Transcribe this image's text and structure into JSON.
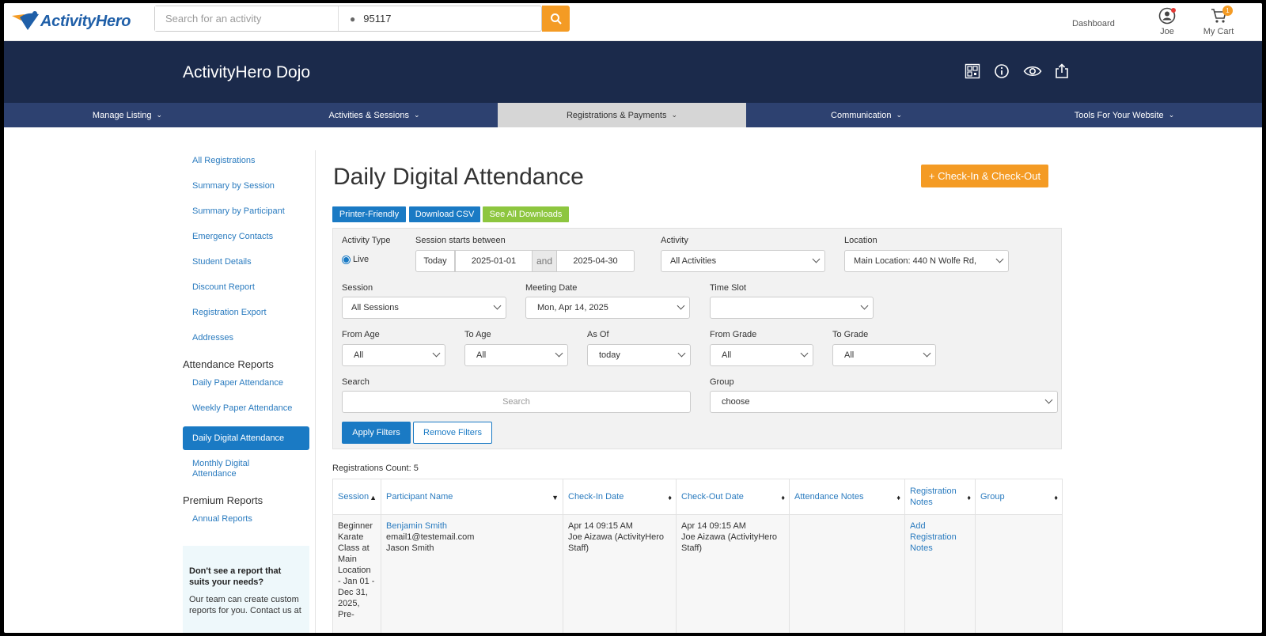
{
  "topbar": {
    "brand": "ActivityHero",
    "search_placeholder": "Search for an activity",
    "zip": "95117",
    "dashboard": "Dashboard",
    "user": "Joe",
    "cart": "My Cart",
    "cart_count": "1"
  },
  "header": {
    "org_name": "ActivityHero Dojo"
  },
  "nav": [
    {
      "label": "Manage Listing"
    },
    {
      "label": "Activities & Sessions"
    },
    {
      "label": "Registrations & Payments"
    },
    {
      "label": "Communication"
    },
    {
      "label": "Tools For Your Website"
    }
  ],
  "sidebar": {
    "links": [
      "All Registrations",
      "Summary by Session",
      "Summary by Participant",
      "Emergency Contacts",
      "Student Details",
      "Discount Report",
      "Registration Export",
      "Addresses"
    ],
    "attendance_heading": "Attendance Reports",
    "attendance_links": [
      "Daily Paper Attendance",
      "Weekly Paper Attendance",
      "Daily Digital Attendance",
      "Monthly Digital Attendance"
    ],
    "premium_heading": "Premium Reports",
    "premium_links": [
      "Annual Reports"
    ],
    "help_question": "Don't see a report that suits your needs?",
    "help_answer": "Our team can create custom reports for you. Contact us at"
  },
  "main": {
    "title": "Daily Digital Attendance",
    "checkin_button": "+ Check-In & Check-Out",
    "printer_friendly": "Printer-Friendly",
    "download_csv": "Download CSV",
    "see_all_downloads": "See All Downloads"
  },
  "filters": {
    "activity_type_label": "Activity Type",
    "activity_type_value": "Live",
    "session_starts_label": "Session starts between",
    "today": "Today",
    "start_date": "2025-01-01",
    "and": "and",
    "end_date": "2025-04-30",
    "activity_label": "Activity",
    "activity_value": "All Activities",
    "location_label": "Location",
    "location_value": "Main Location: 440 N Wolfe Rd,",
    "session_label": "Session",
    "session_value": "All Sessions",
    "meeting_date_label": "Meeting Date",
    "meeting_date_value": "Mon, Apr 14, 2025",
    "time_slot_label": "Time Slot",
    "time_slot_value": "",
    "from_age_label": "From Age",
    "from_age_value": "All",
    "to_age_label": "To Age",
    "to_age_value": "All",
    "as_of_label": "As Of",
    "as_of_value": "today",
    "from_grade_label": "From Grade",
    "from_grade_value": "All",
    "to_grade_label": "To Grade",
    "to_grade_value": "All",
    "search_label": "Search",
    "search_placeholder": "Search",
    "group_label": "Group",
    "group_value": "choose",
    "apply": "Apply Filters",
    "remove": "Remove Filters"
  },
  "results": {
    "count_text": "Registrations Count: 5",
    "columns": [
      "Session",
      "Participant Name",
      "Check-In Date",
      "Check-Out Date",
      "Attendance Notes",
      "Registration Notes",
      "Group"
    ],
    "rows": [
      {
        "session": "Beginner Karate Class at Main Location - Jan 01 - Dec 31, 2025, Pre-",
        "participant_name": "Benjamin Smith",
        "participant_email": "email1@testemail.com",
        "participant_parent": "Jason Smith",
        "checkin_time": "Apr 14 09:15 AM",
        "checkin_by": "Joe Aizawa (ActivityHero Staff)",
        "checkout_time": "Apr 14 09:15 AM",
        "checkout_by": "Joe Aizawa (ActivityHero Staff)",
        "attendance_notes": "",
        "registration_notes": "Add Registration Notes",
        "group": ""
      }
    ]
  },
  "colors": {
    "brand_blue": "#1f5fa8",
    "header_navy": "#1b2a4b",
    "nav_blue": "#2d4170",
    "accent_orange": "#f49b24",
    "link_blue": "#2a7bbf",
    "button_blue": "#1a7ac4",
    "downloads_green": "#8dc63f"
  }
}
